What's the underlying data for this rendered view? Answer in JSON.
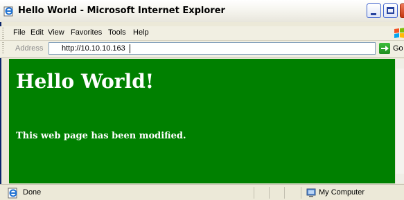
{
  "window": {
    "title": "Hello World - Microsoft Internet Explorer",
    "title_icon": "ie-page-icon",
    "caption_buttons": [
      "minimize-icon",
      "maximize-icon",
      "close-icon"
    ]
  },
  "menubar": {
    "items": [
      "File",
      "Edit",
      "View",
      "Favorites",
      "Tools",
      "Help"
    ],
    "logo_icon": "windows-logo-icon"
  },
  "addressbar": {
    "label": "Address",
    "url": "http://10.10.10.163",
    "go_label": "Go",
    "go_icon": "go-arrow-icon",
    "dropdown_icon": "chevron-down-icon"
  },
  "page": {
    "background": "#008000",
    "text_color": "#ffffff",
    "heading": "Hello World!",
    "paragraph": "This web page has been modified."
  },
  "statusbar": {
    "status": "Done",
    "status_icon": "ie-page-icon",
    "zone": "My Computer",
    "zone_icon": "computer-icon"
  }
}
